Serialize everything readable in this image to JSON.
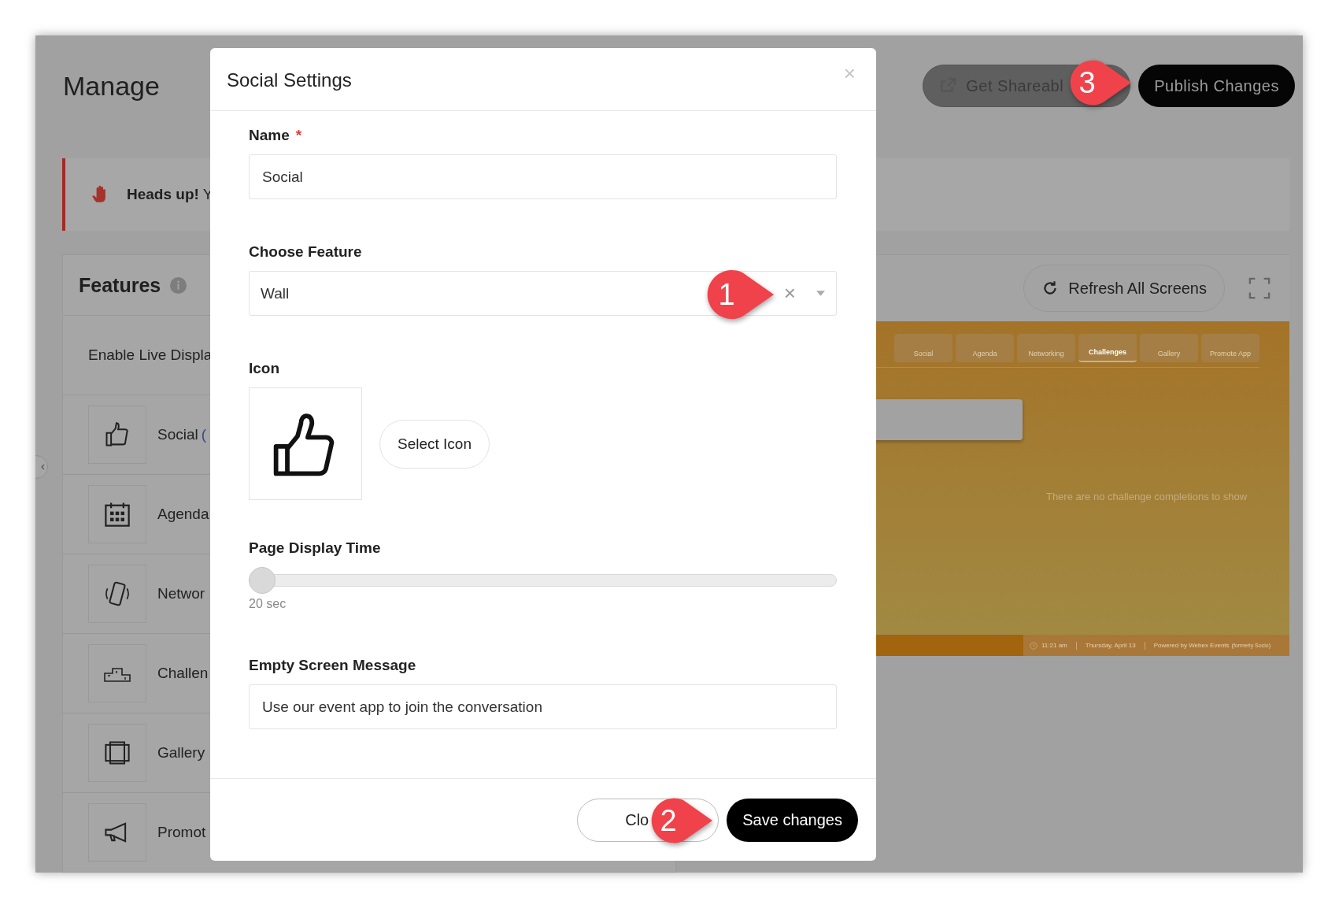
{
  "app": {
    "title": "Manage",
    "header_buttons": [
      {
        "label": "Get Shareabl",
        "kind": "secondary"
      },
      {
        "label": "Publish Changes",
        "kind": "primary"
      }
    ],
    "alert": {
      "text": "**Heads up!** Y"
    },
    "features": {
      "title": "Features",
      "toggle_label": "Enable Live Displa",
      "items": [
        {
          "label": "Social",
          "note": "("
        },
        {
          "label": "Agenda"
        },
        {
          "label": "Networ"
        },
        {
          "label": "Challen"
        },
        {
          "label": "Gallery"
        },
        {
          "label": "Promot"
        }
      ]
    },
    "preview": {
      "refresh_label": "Refresh All Screens",
      "tabs": [
        {
          "label": "Social",
          "selected": false
        },
        {
          "label": "Agenda",
          "selected": false
        },
        {
          "label": "Networking",
          "selected": false
        },
        {
          "label": "Challenges",
          "selected": true
        },
        {
          "label": "Gallery",
          "selected": false
        },
        {
          "label": "Promote App",
          "selected": false
        }
      ],
      "empty_message": "There are no challenge completions to show",
      "footer": {
        "time": "11:21 am",
        "date": "Thursday, April 13",
        "powered": "Powered by Webex Events",
        "powered_note": "(formerly Socio)"
      }
    }
  },
  "modal": {
    "title": "Social Settings",
    "close": "×",
    "fields": [
      {
        "kind": "text",
        "label": "Name",
        "required_mark": "*",
        "value": "Social"
      },
      {
        "kind": "select",
        "label": "Choose Feature",
        "value": "Wall",
        "clear": "×"
      },
      {
        "kind": "icon",
        "label": "Icon",
        "button": "Select Icon"
      },
      {
        "kind": "slider",
        "label": "Page Display Time",
        "level": 0,
        "reading": "20 sec"
      },
      {
        "kind": "text",
        "label": "Empty Screen Message",
        "value": "Use our event app to join the conversation"
      }
    ],
    "buttons": [
      {
        "label": "Clo",
        "kind": "secondary"
      },
      {
        "label": "Save changes",
        "kind": "primary"
      }
    ]
  },
  "callouts": [
    "1",
    "2",
    "3"
  ]
}
